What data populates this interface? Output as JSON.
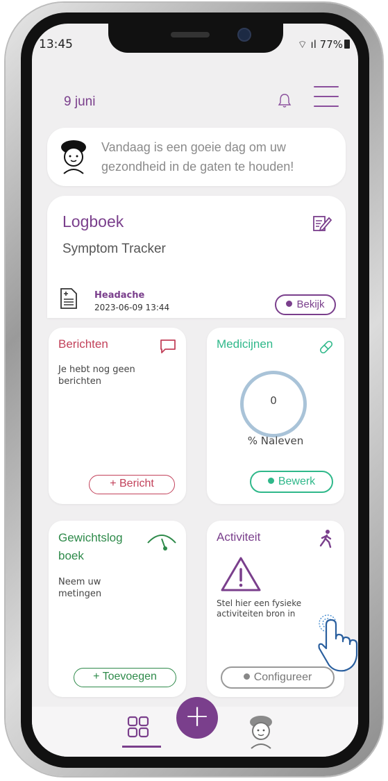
{
  "status_bar": {
    "time": "13:45",
    "battery": "77%"
  },
  "header": {
    "date": "9 juni"
  },
  "banner": {
    "message": "Vandaag is een goeie dag om uw gezondheid in de gaten te houden!"
  },
  "logbook": {
    "title": "Logboek",
    "subtitle": "Symptom Tracker",
    "entry_name": "Headache",
    "entry_date": "2023-06-09 13:44",
    "view_label": "Bekijk"
  },
  "messages": {
    "title": "Berichten",
    "empty_text": "Je hebt nog geen berichten",
    "add_label": "+ Bericht",
    "color": "#c2415a"
  },
  "medicines": {
    "title": "Medicijnen",
    "adherence_value": "0",
    "adherence_label": "% Naleven",
    "edit_label": "Bewerk",
    "color": "#2fb88a"
  },
  "weight": {
    "title": "Gewichtslog boek",
    "body_text": "Neem uw metingen",
    "add_label": "+ Toevoegen",
    "color": "#2e8a4a"
  },
  "activity": {
    "title": "Activiteit",
    "body_text": "Stel hier een fysieke activiteiten bron in",
    "configure_label": "Configureer",
    "color": "#7a3f8c"
  },
  "nav": {
    "fab_label": "+",
    "accent": "#7a3f8c"
  },
  "icons": [
    "bell-icon",
    "menu-icon",
    "avatar-icon",
    "edit-note-icon",
    "document-icon",
    "chat-icon",
    "pill-icon",
    "gauge-icon",
    "walking-icon",
    "warning-icon",
    "dashboard-icon",
    "plus-icon",
    "tap-hand-icon"
  ]
}
